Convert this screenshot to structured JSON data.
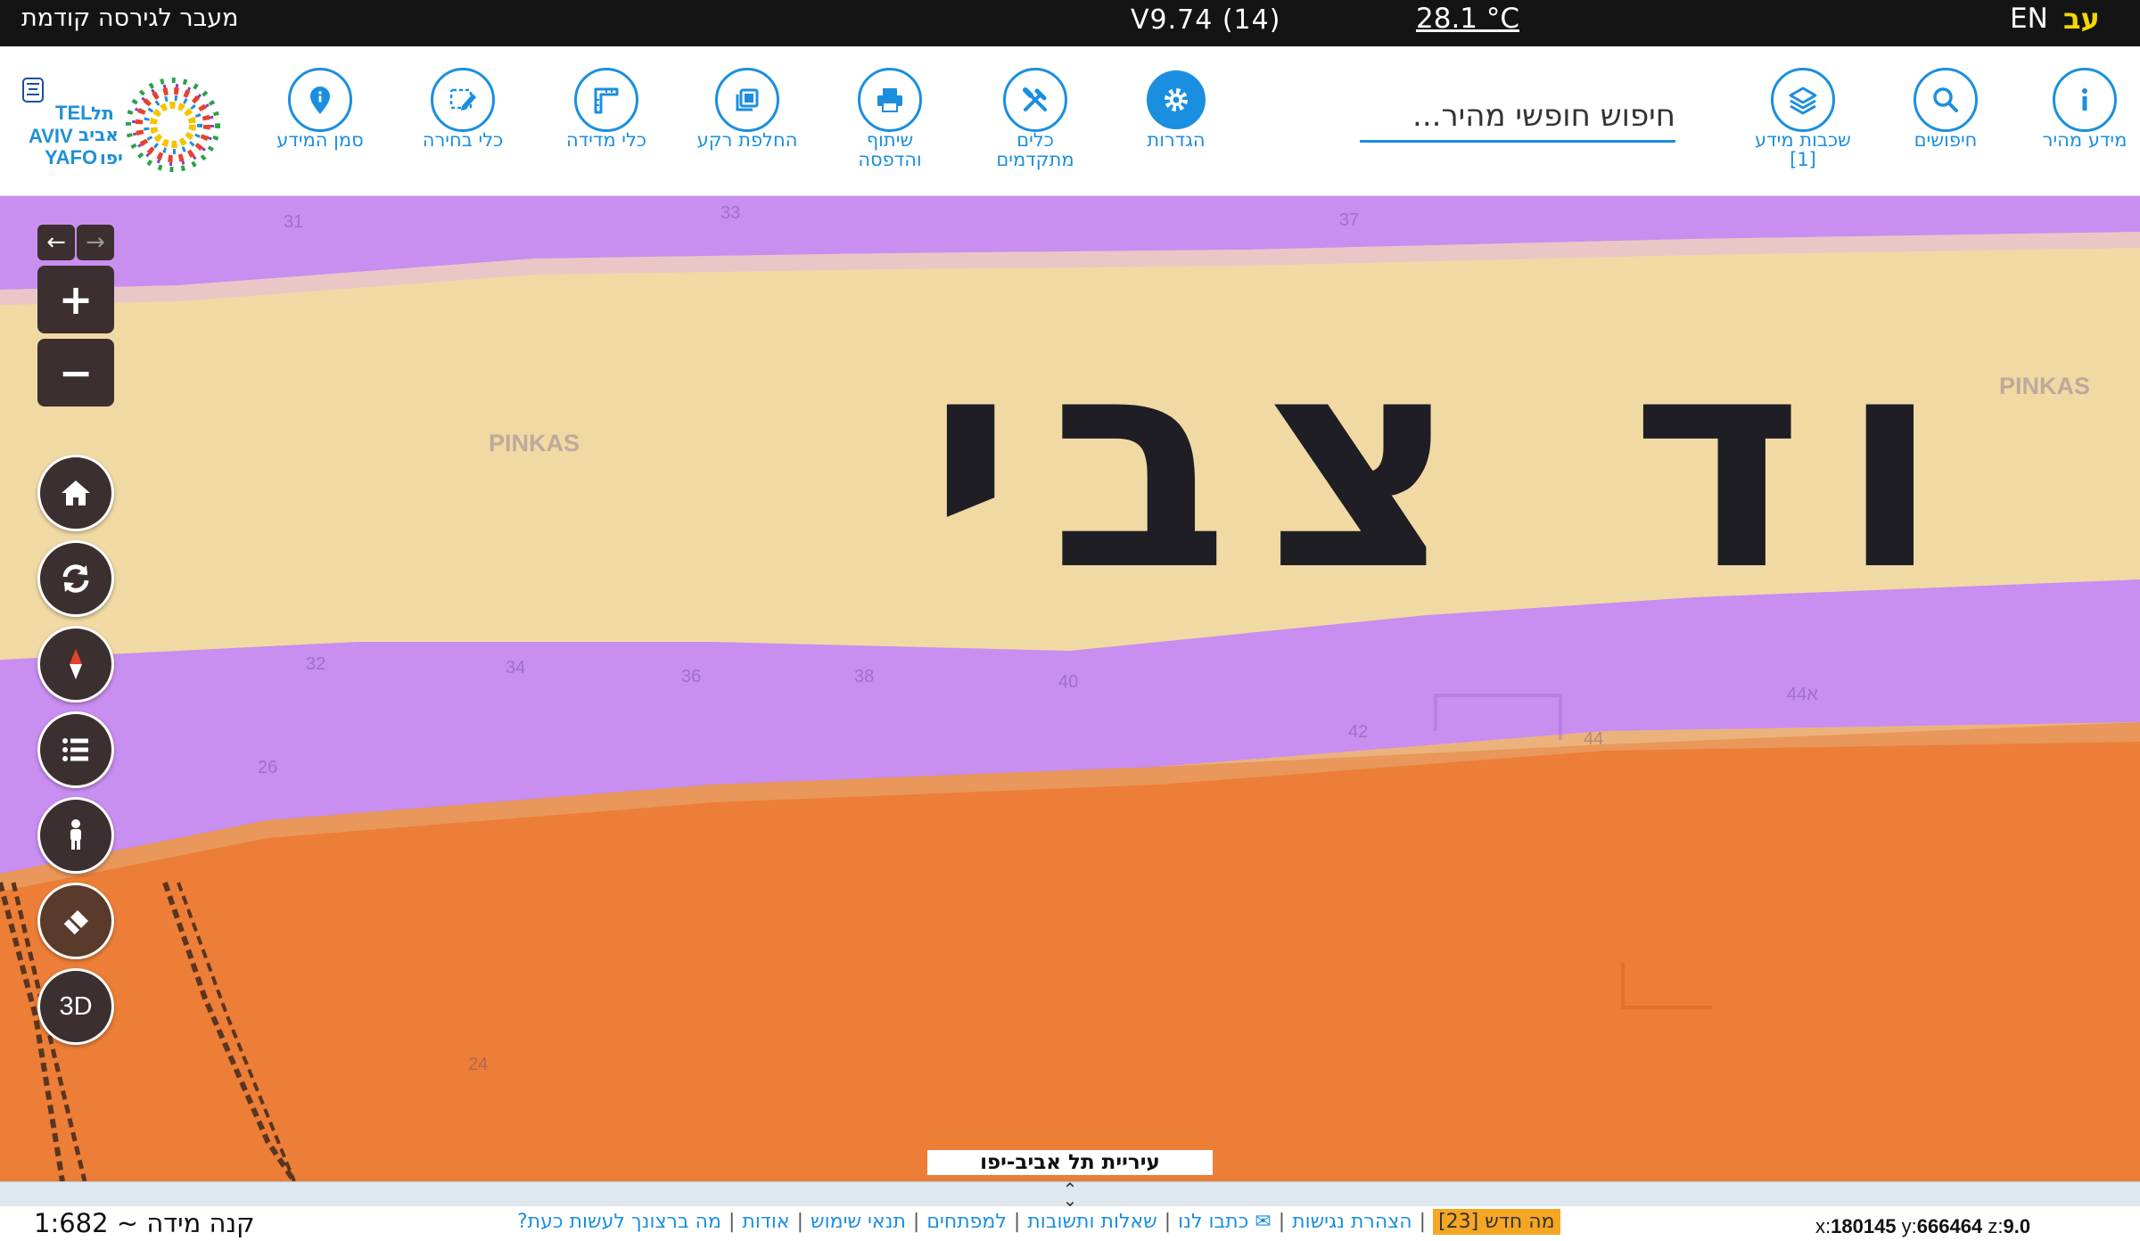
{
  "topbar": {
    "prev_version": "מעבר לגירסה קודמת",
    "version": "V9.74 (14)",
    "temperature": "28.1 °C",
    "lang_en": "EN",
    "lang_he": "עב"
  },
  "toolbar": {
    "search_placeholder": "חיפוש חופשי מהיר...",
    "tools": [
      {
        "label1": "מידע מהיר",
        "label2": "",
        "icon": "info-icon"
      },
      {
        "label1": "חיפושים",
        "label2": "",
        "icon": "search-icon"
      },
      {
        "label1": "שכבות מידע",
        "label2": "[1]",
        "icon": "layers-icon"
      },
      {
        "label1": "הגדרות",
        "label2": "",
        "icon": "gear-icon"
      },
      {
        "label1": "כלים",
        "label2": "מתקדמים",
        "icon": "tools-icon"
      },
      {
        "label1": "שיתוף",
        "label2": "והדפסה",
        "icon": "printer-icon"
      },
      {
        "label1": "החלפת רקע",
        "label2": "",
        "icon": "basemap-icon"
      },
      {
        "label1": "כלי מדידה",
        "label2": "",
        "icon": "ruler-icon"
      },
      {
        "label1": "כלי בחירה",
        "label2": "",
        "icon": "select-icon"
      },
      {
        "label1": "סמן המידע",
        "label2": "",
        "icon": "pin-icon"
      }
    ],
    "logo_text": [
      "TEL",
      "AVIV",
      "YAFO",
      "תל",
      "אביב",
      "יפו"
    ]
  },
  "map": {
    "street_name": "וד צבי",
    "street_label": "PINKAS",
    "house_numbers": [
      "31",
      "33",
      "37",
      "32",
      "34",
      "36",
      "38",
      "40",
      "42",
      "44",
      "44א",
      "26",
      "24"
    ],
    "attribution": "עיריית תל אביב-יפו",
    "controls": {
      "back": "←",
      "forward": "→",
      "zoom_in": "+",
      "zoom_out": "−",
      "three_d": "3D"
    },
    "colors": {
      "purple": "#c88ef0",
      "beige": "#f1d9a4",
      "orange": "#ec7e37",
      "control_bg": "#3b2f2f",
      "accent": "#1a8fe0"
    }
  },
  "footer": {
    "scale": "קנה מידה ~ 1:682",
    "links": [
      "מה ברצונך לעשות כעת?",
      "אודות",
      "תנאי שימוש",
      "למפתחים",
      "שאלות ותשובות",
      "✉ כתבו לנו",
      "הצהרת נגישות"
    ],
    "news": "מה חדש [23]",
    "coords": {
      "x_label": "x:",
      "x": "180145",
      "y_label": "y:",
      "y": "666464",
      "z_label": "z:",
      "z": "9.0"
    }
  }
}
